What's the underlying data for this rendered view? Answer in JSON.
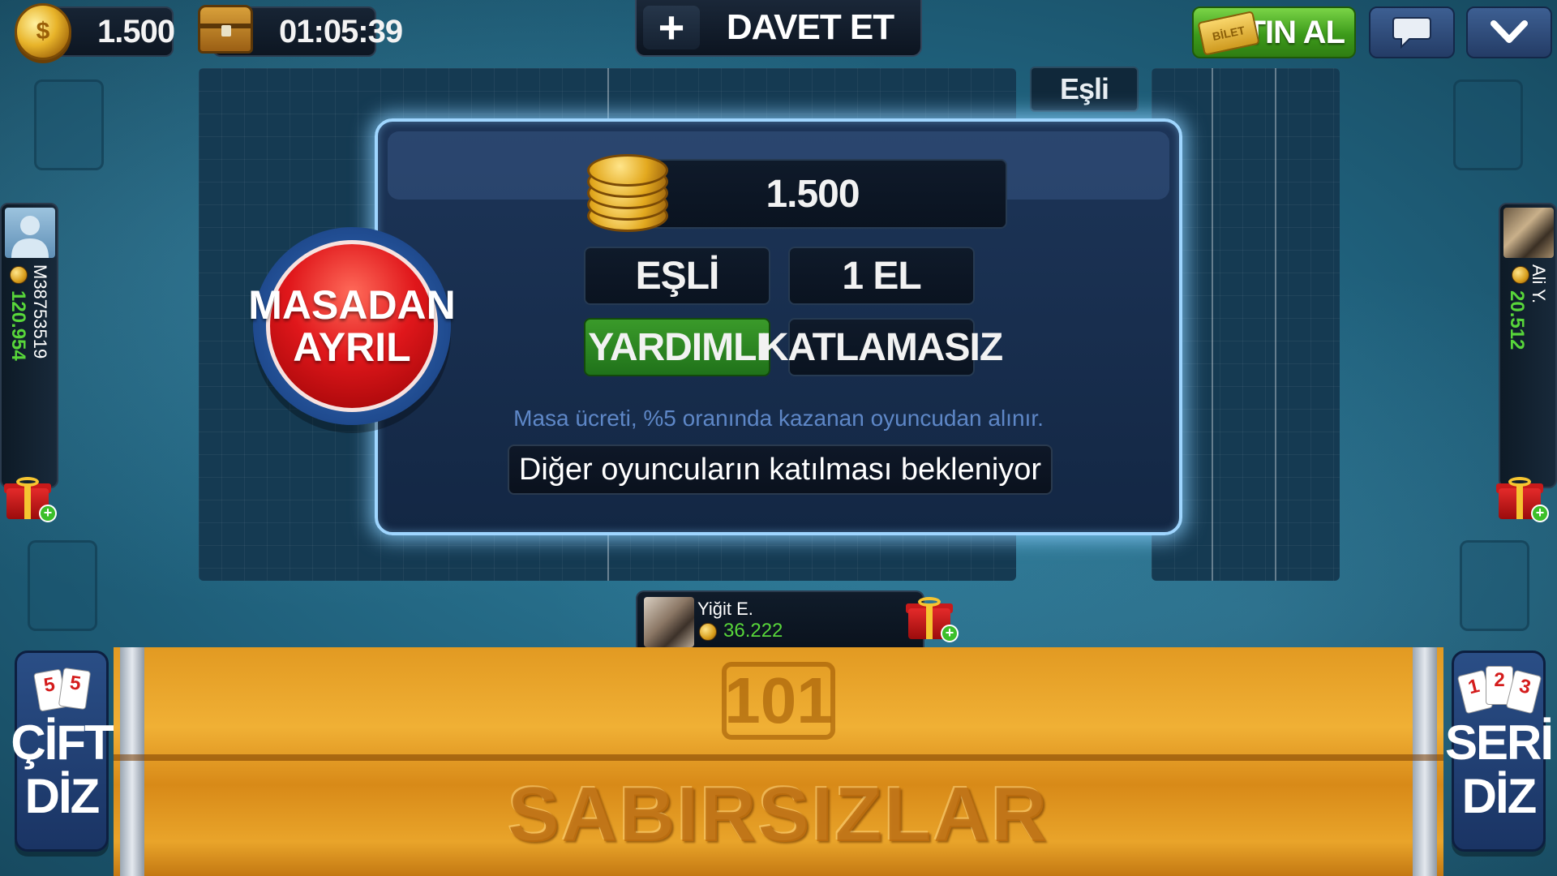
{
  "top_bar": {
    "coins": "1.500",
    "timer": "01:05:39",
    "invite_label": "DAVET ET",
    "buy_label": "SATIN AL",
    "ticket_label": "BİLET",
    "icons": [
      "coin-stack-icon",
      "treasure-chest-icon",
      "plus-icon",
      "chat-icon",
      "chevron-down-icon"
    ]
  },
  "table": {
    "tag": "Eşli"
  },
  "modal": {
    "stake": "1.500",
    "mode": "EŞLİ",
    "rounds": "1 EL",
    "assist": "YARDIMLI",
    "doubling": "KATLAMASIZ",
    "fee_note": "Masa ücreti, %5 oranında kazanan oyuncudan alınır.",
    "status": "Diğer oyuncuların katılması bekleniyor"
  },
  "leave_button": {
    "line1": "MASADAN",
    "line2": "AYRIL"
  },
  "players": {
    "left": {
      "name": "M38753519",
      "coins": "120.954"
    },
    "right": {
      "name": "Ali Y.",
      "coins": "20.512"
    },
    "bottom": {
      "name": "Yiğit E.",
      "coins": "36.222"
    }
  },
  "rack": {
    "logo": "101",
    "brand": "SABIRSIZLAR"
  },
  "side_buttons": {
    "left": {
      "cards": [
        "5",
        "5"
      ],
      "line1": "ÇİFT",
      "line2": "DİZ"
    },
    "right": {
      "cards": [
        "1",
        "2",
        "3"
      ],
      "line1": "SERİ",
      "line2": "DİZ"
    }
  },
  "colors": {
    "accent_green": "#3c9a1a",
    "leave_red": "#e0171b",
    "coins_green": "#58d63a",
    "modal_glow": "#9fd6ff"
  }
}
